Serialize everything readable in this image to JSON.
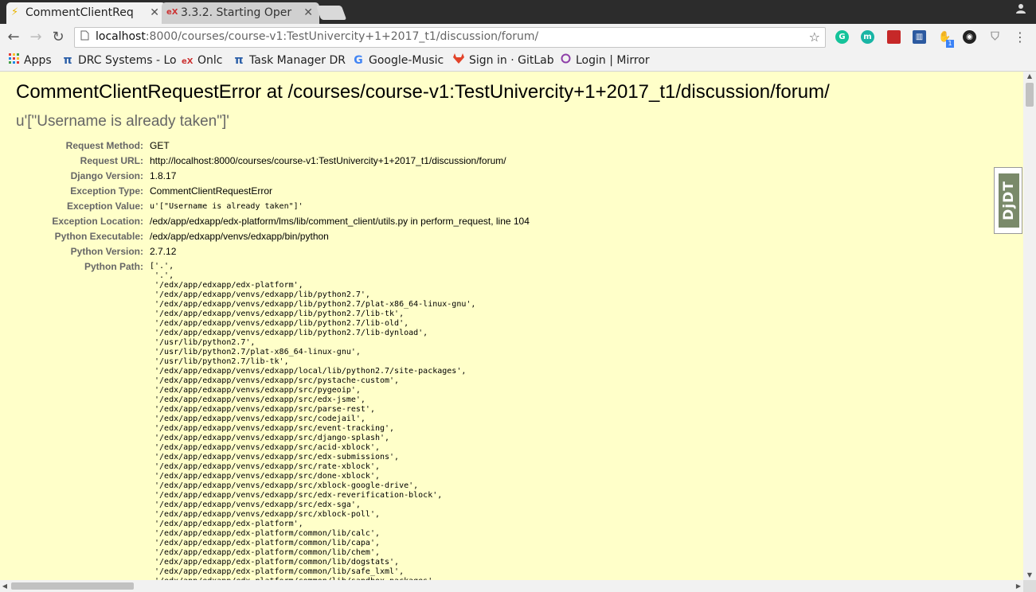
{
  "browser": {
    "tabs": [
      {
        "title": "CommentClientReq",
        "favicon": "lightning-icon",
        "active": true
      },
      {
        "title": "3.3.2. Starting Oper",
        "favicon": "edx-icon",
        "active": false
      }
    ],
    "close_glyph": "✕",
    "address": {
      "host": "localhost",
      "path": ":8000/courses/course-v1:TestUnivercity+1+2017_t1/discussion/forum/"
    },
    "extension_badge": "1",
    "bookmarks": [
      {
        "label": "Apps",
        "icon": "apps-grid-icon"
      },
      {
        "label": "DRC Systems - Lo",
        "icon": "pi-icon"
      },
      {
        "label": "Onlc",
        "icon": "edx-icon"
      },
      {
        "label": "Task Manager DR",
        "icon": "pi-icon"
      },
      {
        "label": "Google-Music",
        "icon": "google-icon"
      },
      {
        "label": "Sign in · GitLab",
        "icon": "gitlab-icon"
      },
      {
        "label": "Login | Mirror",
        "icon": "mirror-icon"
      }
    ]
  },
  "error": {
    "title": "CommentClientRequestError at /courses/course-v1:TestUnivercity+1+2017_t1/discussion/forum/",
    "subtitle": "u'[\"Username is already taken\"]'",
    "meta": [
      {
        "key": "Request Method:",
        "value": "GET"
      },
      {
        "key": "Request URL:",
        "value": "http://localhost:8000/courses/course-v1:TestUnivercity+1+2017_t1/discussion/forum/"
      },
      {
        "key": "Django Version:",
        "value": "1.8.17"
      },
      {
        "key": "Exception Type:",
        "value": "CommentClientRequestError"
      },
      {
        "key": "Exception Value:",
        "value": "u'[\"Username is already taken\"]'"
      },
      {
        "key": "Exception Location:",
        "value": "/edx/app/edxapp/edx-platform/lms/lib/comment_client/utils.py in perform_request, line 104"
      },
      {
        "key": "Python Executable:",
        "value": "/edx/app/edxapp/venvs/edxapp/bin/python"
      },
      {
        "key": "Python Version:",
        "value": "2.7.12"
      },
      {
        "key": "Python Path:",
        "value": ""
      }
    ],
    "python_path": [
      "['.',",
      " '.',",
      " '/edx/app/edxapp/edx-platform',",
      " '/edx/app/edxapp/venvs/edxapp/lib/python2.7',",
      " '/edx/app/edxapp/venvs/edxapp/lib/python2.7/plat-x86_64-linux-gnu',",
      " '/edx/app/edxapp/venvs/edxapp/lib/python2.7/lib-tk',",
      " '/edx/app/edxapp/venvs/edxapp/lib/python2.7/lib-old',",
      " '/edx/app/edxapp/venvs/edxapp/lib/python2.7/lib-dynload',",
      " '/usr/lib/python2.7',",
      " '/usr/lib/python2.7/plat-x86_64-linux-gnu',",
      " '/usr/lib/python2.7/lib-tk',",
      " '/edx/app/edxapp/venvs/edxapp/local/lib/python2.7/site-packages',",
      " '/edx/app/edxapp/venvs/edxapp/src/pystache-custom',",
      " '/edx/app/edxapp/venvs/edxapp/src/pygeoip',",
      " '/edx/app/edxapp/venvs/edxapp/src/edx-jsme',",
      " '/edx/app/edxapp/venvs/edxapp/src/parse-rest',",
      " '/edx/app/edxapp/venvs/edxapp/src/codejail',",
      " '/edx/app/edxapp/venvs/edxapp/src/event-tracking',",
      " '/edx/app/edxapp/venvs/edxapp/src/django-splash',",
      " '/edx/app/edxapp/venvs/edxapp/src/acid-xblock',",
      " '/edx/app/edxapp/venvs/edxapp/src/edx-submissions',",
      " '/edx/app/edxapp/venvs/edxapp/src/rate-xblock',",
      " '/edx/app/edxapp/venvs/edxapp/src/done-xblock',",
      " '/edx/app/edxapp/venvs/edxapp/src/xblock-google-drive',",
      " '/edx/app/edxapp/venvs/edxapp/src/edx-reverification-block',",
      " '/edx/app/edxapp/venvs/edxapp/src/edx-sga',",
      " '/edx/app/edxapp/venvs/edxapp/src/xblock-poll',",
      " '/edx/app/edxapp/edx-platform',",
      " '/edx/app/edxapp/edx-platform/common/lib/calc',",
      " '/edx/app/edxapp/edx-platform/common/lib/capa',",
      " '/edx/app/edxapp/edx-platform/common/lib/chem',",
      " '/edx/app/edxapp/edx-platform/common/lib/dogstats',",
      " '/edx/app/edxapp/edx-platform/common/lib/safe_lxml',",
      " '/edx/app/edxapp/edx-platform/common/lib/sandbox-packages',"
    ]
  },
  "djdt": {
    "label": "DjDT"
  }
}
